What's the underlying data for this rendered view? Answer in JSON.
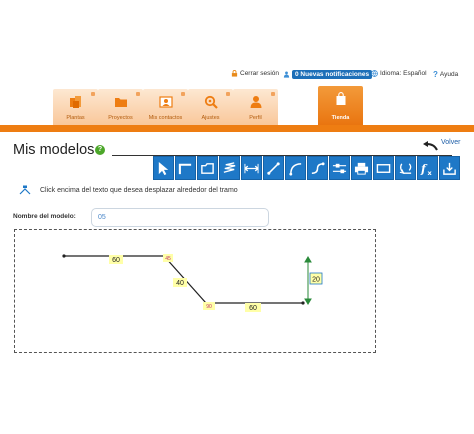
{
  "topbar": {
    "logout": "Cerrar sesión",
    "notifications": "0 Nuevas notificaciones",
    "language": "Idioma: Español",
    "help": "Ayuda"
  },
  "nav": {
    "tabs": [
      {
        "label": "Plantas",
        "icon": "plants-icon"
      },
      {
        "label": "Proyectos",
        "icon": "folder-icon"
      },
      {
        "label": "Mis contactos",
        "icon": "contacts-icon"
      },
      {
        "label": "Ajustes",
        "icon": "settings-search-icon"
      },
      {
        "label": "Perfil",
        "icon": "user-icon"
      },
      {
        "label": "Tienda",
        "icon": "shopping-bag-icon",
        "active": true
      }
    ]
  },
  "page": {
    "title": "Mis modelos",
    "help_glyph": "?",
    "back_label": "Volver",
    "hint": "Click encima del texto que desea desplazar alrededor del tramo"
  },
  "toolbar": {
    "tools": [
      "pointer-icon",
      "right-angle-icon",
      "box-icon",
      "spring-icon",
      "horizontal-dimension-icon",
      "diagonal-line-icon",
      "arc-icon",
      "s-curve-icon",
      "segment-settings-icon",
      "printer-icon",
      "rectangle-icon",
      "rotate-icon",
      "formula-icon",
      "save-icon"
    ]
  },
  "form": {
    "name_label": "Nombre del modelo:",
    "name_value": "05"
  },
  "drawing": {
    "segment_labels": [
      "60",
      "40",
      "60",
      "20"
    ],
    "angle_labels": [
      "45",
      "90"
    ],
    "accent_color": "#ee7d12",
    "label_bg": "#ffffa8"
  }
}
